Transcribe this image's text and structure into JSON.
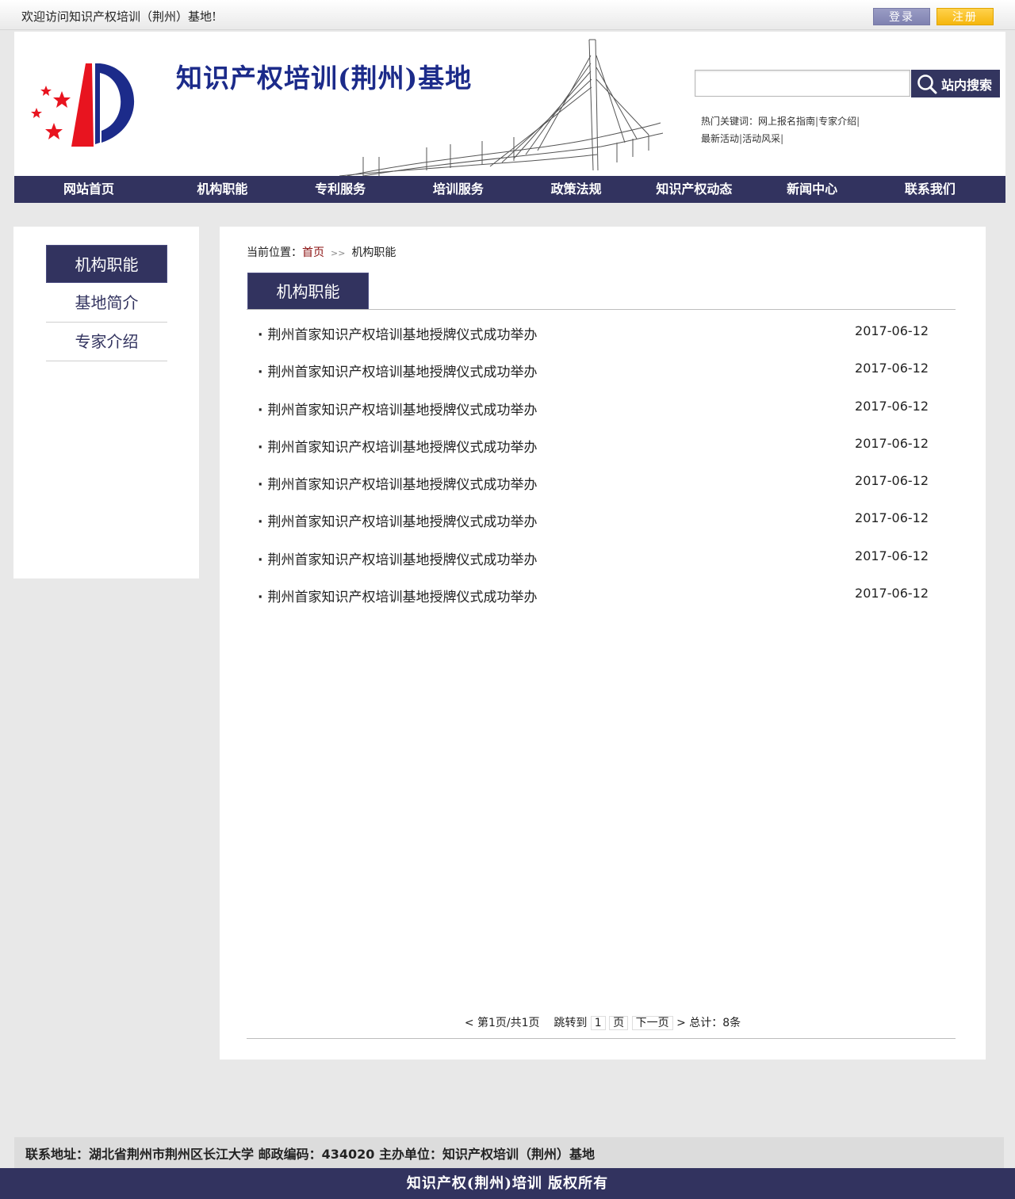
{
  "topbar": {
    "welcome": "欢迎访问知识产权培训（荆州）基地!",
    "login_label": "登录",
    "register_label": "注册"
  },
  "header": {
    "site_title": "知识产权培训(荆州)基地",
    "search_placeholder": "",
    "search_button_label": "站内搜索",
    "hotwords_label": "热门关键词：",
    "hotwords": [
      "网上报名指南",
      "专家介绍",
      "最新活动",
      "活动风采"
    ]
  },
  "nav": {
    "items": [
      "网站首页",
      "机构职能",
      "专利服务",
      "培训服务",
      "政策法规",
      "知识产权动态",
      "新闻中心",
      "联系我们"
    ]
  },
  "sidebar": {
    "active": "机构职能",
    "items": [
      "基地简介",
      "专家介绍"
    ]
  },
  "main": {
    "breadcrumb_label": "当前位置：",
    "breadcrumb_home": "首页",
    "breadcrumb_arrow": ">>",
    "breadcrumb_current": "机构职能",
    "tab_title": "机构职能",
    "news": [
      {
        "title": "荆州首家知识产权培训基地授牌仪式成功举办",
        "date": "2017-06-12"
      },
      {
        "title": "荆州首家知识产权培训基地授牌仪式成功举办",
        "date": "2017-06-12"
      },
      {
        "title": "荆州首家知识产权培训基地授牌仪式成功举办",
        "date": "2017-06-12"
      },
      {
        "title": "荆州首家知识产权培训基地授牌仪式成功举办",
        "date": "2017-06-12"
      },
      {
        "title": "荆州首家知识产权培训基地授牌仪式成功举办",
        "date": "2017-06-12"
      },
      {
        "title": "荆州首家知识产权培训基地授牌仪式成功举办",
        "date": "2017-06-12"
      },
      {
        "title": "荆州首家知识产权培训基地授牌仪式成功举办",
        "date": "2017-06-12"
      },
      {
        "title": "荆州首家知识产权培训基地授牌仪式成功举办",
        "date": "2017-06-12"
      }
    ],
    "pager": {
      "prev": "<",
      "page_info": "第1页/共1页",
      "jump_label": "跳转到",
      "jump_value": "1",
      "page_unit": "页",
      "next_label": "下一页",
      "next": ">",
      "total": "总计：8条"
    }
  },
  "footer": {
    "info": "联系地址：湖北省荆州市荆州区长江大学 邮政编码：434020 主办单位：知识产权培训（荆州）基地",
    "copyright": "知识产权(荆州)培训 版权所有"
  },
  "colors": {
    "primary": "#32335f",
    "login": "#8a8cb8",
    "register": "#f5b60c",
    "title": "#1c2b8a",
    "breadcrumb_home": "#8a1010"
  }
}
